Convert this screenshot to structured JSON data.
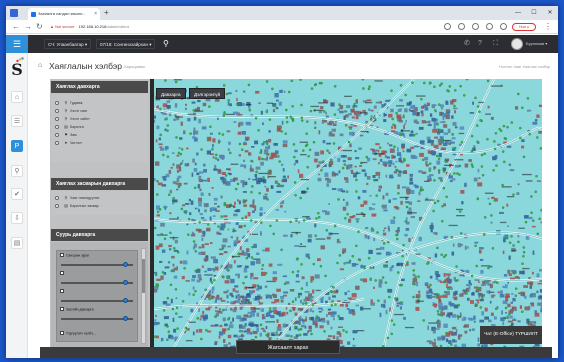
{
  "browser": {
    "tab_title": "Захиалга сандал көшнл...",
    "tab_close": "×",
    "new_tab": "+",
    "back": "←",
    "forward": "→",
    "reload": "↻",
    "not_secure": "▲ Not secure",
    "url_host": "192.168.10.216",
    "url_path": "/admin/client",
    "profile_label": "Ном ●",
    "menu": "⋮",
    "win_min": "—",
    "win_max": "☐",
    "win_close": "✕"
  },
  "appbar": {
    "menu_icon": "☰",
    "city_select": "СЧ: Улаанбаатар ▾",
    "district_select": "07/18: Сонгинохайрхан ▾",
    "search_icon": "⚲",
    "user_name": "Бүрэнжав ▾"
  },
  "rail": {
    "logo": "S",
    "items": [
      "⌂",
      "☰",
      "P",
      "⚲",
      "✔",
      "⇩",
      "▤"
    ]
  },
  "page": {
    "home_icon": "⌂",
    "title": "Хаяглалын хэлбэр",
    "subtitle": "Харьцааны",
    "breadcrumb": "Нэгтгэл Хаяг   Хаяглах хэлбэр"
  },
  "panel": {
    "section1_title": "Хаяглах давхарга",
    "section1_items": [
      {
        "icon": "⚲",
        "label": "Гудамж"
      },
      {
        "icon": "⚲",
        "label": "Хэсэг хаяг"
      },
      {
        "icon": "⚲",
        "label": "Хэсэг хайлт"
      },
      {
        "icon": "▤",
        "label": "Барилга"
      },
      {
        "icon": "⚑",
        "label": "Зам"
      },
      {
        "icon": "➤",
        "label": "Чиглэл"
      }
    ],
    "section2_title": "Хаяглах засварын давхарга",
    "section2_items": [
      {
        "icon": "⚲",
        "label": "Хаяг нэмэгдүүлэх"
      },
      {
        "icon": "▤",
        "label": "Барилгын засвар"
      }
    ],
    "section3_title": "Суурь давхарга",
    "sliders": [
      {
        "label": "Сансрын зураг",
        "checked": true,
        "level": 0.9
      },
      {
        "label": "",
        "checked": true,
        "level": 0.9
      },
      {
        "label": "",
        "checked": true,
        "level": 0.9
      },
      {
        "label": "Засгийн давхарга",
        "checked": true,
        "level": 0.9
      }
    ],
    "last_item": "Тэргүүлэгч хэлбэ..."
  },
  "map": {
    "tab_layer": "Давхарга",
    "tab_manage": "Дэлгэрэнгүй",
    "chat_label": "Чат (E-Office) ТҮРШИЛТ"
  },
  "bottom": {
    "label": "Жагсаалт харах"
  },
  "colors": {
    "accent": "#2f8fd8",
    "map_water": "#8ad7dc",
    "panel_bg": "#c2c4c6",
    "dark_bar": "#2b2d33"
  }
}
